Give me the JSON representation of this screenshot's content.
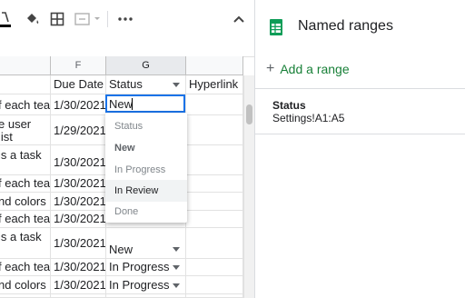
{
  "toolbar": {
    "icons": [
      "text-color-icon",
      "fill-color-icon",
      "borders-icon",
      "merge-cells-icon",
      "more-icon",
      "collapse-icon"
    ]
  },
  "columns": [
    {
      "letter": "F"
    },
    {
      "letter": "G"
    }
  ],
  "header_row": {
    "e": "",
    "due_date": "Due Date",
    "status": "Status",
    "hyperlink": "Hyperlink"
  },
  "rows": [
    {
      "e": "f each tea",
      "f": "1/30/2021",
      "g": "New"
    },
    {
      "e1": "e user",
      "e2": "list",
      "f": "1/29/2021",
      "g": ""
    },
    {
      "e1": " is a task",
      "e2": "",
      "f": "1/30/2021",
      "g": ""
    },
    {
      "e": "f each tea",
      "f": "1/30/2021",
      "g": ""
    },
    {
      "e": "nd colors",
      "f": "1/30/2021",
      "g": ""
    },
    {
      "e": "f each tea",
      "f": "1/30/2021",
      "g": ""
    },
    {
      "e1": " is a task",
      "e2": "",
      "f": "1/30/2021",
      "g": "New"
    },
    {
      "e": "f each tea",
      "f": "1/30/2021",
      "g": "In Progress"
    },
    {
      "e": "nd colors",
      "f": "1/30/2021",
      "g": "In Progress"
    }
  ],
  "dropdown": {
    "items": [
      {
        "label": "Status"
      },
      {
        "label": "New"
      },
      {
        "label": "In Progress"
      },
      {
        "label": "In Review"
      },
      {
        "label": "Done"
      }
    ]
  },
  "panel": {
    "title": "Named ranges",
    "add_label": "Add a range",
    "add_symbol": "+",
    "ranges": [
      {
        "name": "Status",
        "ref": "Settings!A1:A5"
      }
    ]
  },
  "colors": {
    "selection": "#1a73e8",
    "add_range": "#188038",
    "sheets_green": "#0f9d58"
  }
}
